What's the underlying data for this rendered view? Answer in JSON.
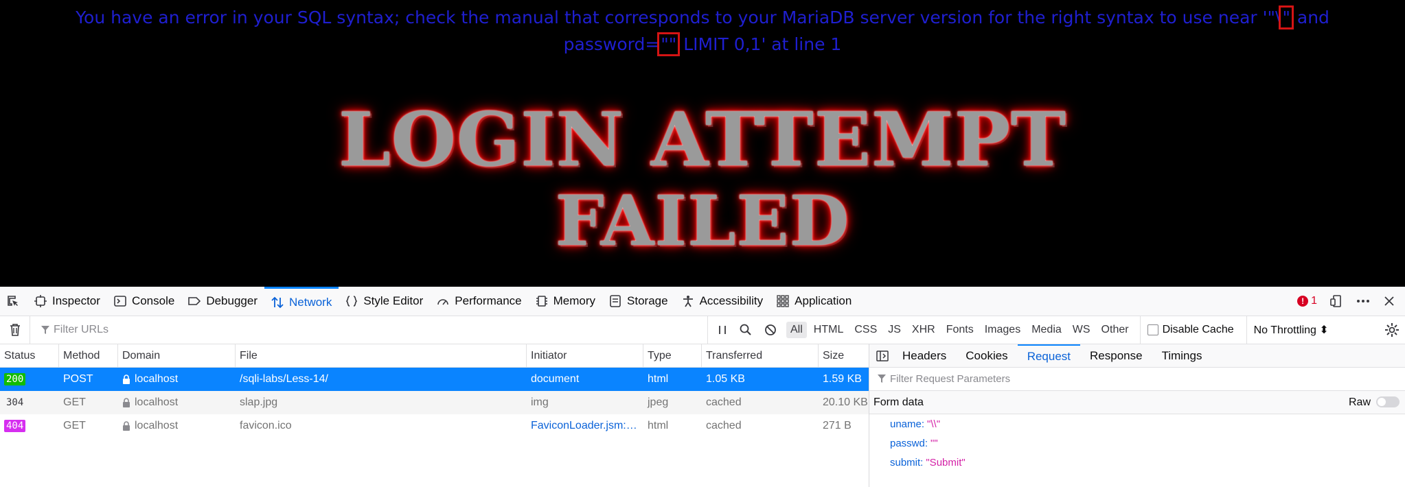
{
  "page": {
    "error_part1": "You have an error in your SQL syntax; check the manual that corresponds to your MariaDB server version for the right syntax to use near '\"\\",
    "error_hl1": "\"",
    "error_part2": " and password=",
    "error_hl2": "\"\"",
    "error_part3": " LIMIT 0,1' at line 1",
    "banner_line1": "LOGIN ATTEMPT",
    "banner_line2": "FAILED"
  },
  "devtools": {
    "tabs": [
      {
        "label": "Inspector",
        "icon": "inspector-icon"
      },
      {
        "label": "Console",
        "icon": "console-icon"
      },
      {
        "label": "Debugger",
        "icon": "debugger-icon"
      },
      {
        "label": "Network",
        "icon": "network-icon",
        "active": true
      },
      {
        "label": "Style Editor",
        "icon": "style-editor-icon"
      },
      {
        "label": "Performance",
        "icon": "performance-icon"
      },
      {
        "label": "Memory",
        "icon": "memory-icon"
      },
      {
        "label": "Storage",
        "icon": "storage-icon"
      },
      {
        "label": "Accessibility",
        "icon": "accessibility-icon"
      },
      {
        "label": "Application",
        "icon": "application-icon"
      }
    ],
    "error_count": "1",
    "filter_placeholder": "Filter URLs",
    "type_filters": [
      "All",
      "HTML",
      "CSS",
      "JS",
      "XHR",
      "Fonts",
      "Images",
      "Media",
      "WS",
      "Other"
    ],
    "disable_cache_label": "Disable Cache",
    "throttling": "No Throttling ⬍",
    "columns": [
      "Status",
      "Method",
      "Domain",
      "File",
      "Initiator",
      "Type",
      "Transferred",
      "Size"
    ],
    "requests": [
      {
        "status": "200",
        "method": "POST",
        "domain": "localhost",
        "file": "/sqli-labs/Less-14/",
        "initiator": "document",
        "type": "html",
        "transferred": "1.05 KB",
        "size": "1.59 KB"
      },
      {
        "status": "304",
        "method": "GET",
        "domain": "localhost",
        "file": "slap.jpg",
        "initiator": "img",
        "type": "jpeg",
        "transferred": "cached",
        "size": "20.10 KB"
      },
      {
        "status": "404",
        "method": "GET",
        "domain": "localhost",
        "file": "favicon.ico",
        "initiator": "FaviconLoader.jsm:…",
        "type": "html",
        "transferred": "cached",
        "size": "271 B"
      }
    ],
    "detail_tabs": [
      "Headers",
      "Cookies",
      "Request",
      "Response",
      "Timings"
    ],
    "params_placeholder": "Filter Request Parameters",
    "form_data_label": "Form data",
    "raw_label": "Raw",
    "form_params": [
      {
        "key": "uname:",
        "value": "\"\\\\\""
      },
      {
        "key": "passwd:",
        "value": "\"\""
      },
      {
        "key": "submit:",
        "value": "\"Submit\""
      }
    ],
    "colors": {
      "accent": "#0a84ff",
      "status_200": "#12bc00",
      "status_404": "#d62ef0"
    }
  }
}
